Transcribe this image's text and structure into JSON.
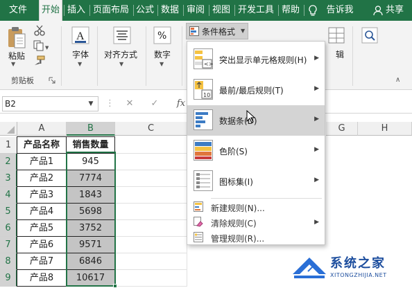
{
  "tabs": {
    "file": "文件",
    "home": "开始",
    "insert": "插入",
    "page_layout": "页面布局",
    "formulas": "公式",
    "data": "数据",
    "review": "审阅",
    "view": "视图",
    "developer": "开发工具",
    "help": "帮助",
    "tell_me": "告诉我",
    "share": "共享"
  },
  "ribbon": {
    "paste": "粘贴",
    "clipboard_group": "剪贴板",
    "font": "字体",
    "alignment": "对齐方式",
    "number": "数字",
    "conditional_formatting": "条件格式",
    "editing_partial": "辑"
  },
  "formula_bar": {
    "name_box": "B2",
    "fx": "fx"
  },
  "columns": [
    "A",
    "B",
    "C",
    "G",
    "H"
  ],
  "rows": [
    "1",
    "2",
    "3",
    "4",
    "5",
    "6",
    "7",
    "8",
    "9"
  ],
  "table": {
    "headers": [
      "产品名称",
      "销售数量"
    ],
    "rows": [
      [
        "产品1",
        "945"
      ],
      [
        "产品2",
        "7774"
      ],
      [
        "产品3",
        "1843"
      ],
      [
        "产品4",
        "5698"
      ],
      [
        "产品5",
        "3752"
      ],
      [
        "产品6",
        "9571"
      ],
      [
        "产品7",
        "6846"
      ],
      [
        "产品8",
        "10617"
      ]
    ]
  },
  "menu": {
    "highlight_cells": "突出显示单元格规则(H)",
    "top_bottom": "最前/最后规则(T)",
    "data_bars": "数据条(D)",
    "color_scales": "色阶(S)",
    "icon_sets": "图标集(I)",
    "new_rule": "新建规则(N)...",
    "clear_rules": "清除规则(C)",
    "manage_rules": "管理规则(R)..."
  },
  "watermark": {
    "title": "系统之家",
    "url": "XITONGZHIJIA.NET"
  },
  "colors": {
    "brand_green": "#217346",
    "selection_gray": "#c4c4c4",
    "highlight_yellow": "#f6f33c"
  }
}
